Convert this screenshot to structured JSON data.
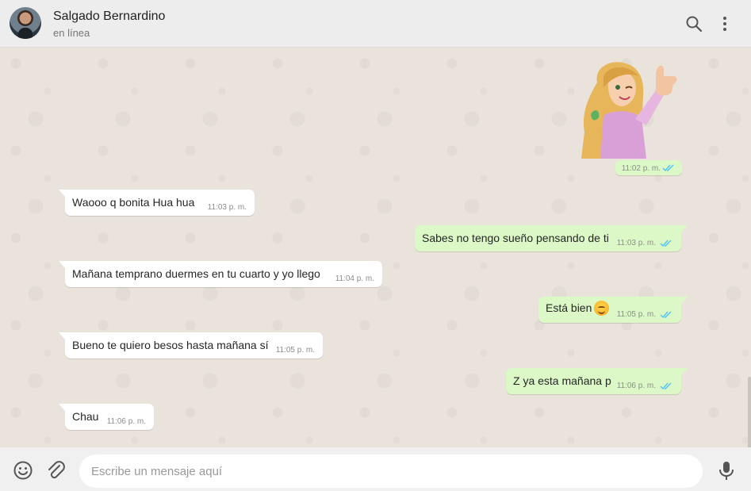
{
  "header": {
    "contact_name": "Salgado Bernardino",
    "contact_status": "en línea",
    "icons": [
      "avatar",
      "search-icon",
      "menu-icon"
    ]
  },
  "messages": [
    {
      "type": "sticker",
      "direction": "out",
      "time": "11:02 p. m.",
      "status": "read"
    },
    {
      "type": "text",
      "direction": "in",
      "text": "Waooo q bonita Hua hua",
      "time": "11:03 p. m."
    },
    {
      "type": "text",
      "direction": "out",
      "text": "Sabes no tengo sueño pensando de ti",
      "time": "11:03 p. m.",
      "status": "read"
    },
    {
      "type": "text",
      "direction": "in",
      "text": "Mañana temprano duermes en tu cuarto y yo llego",
      "time": "11:04 p. m."
    },
    {
      "type": "text",
      "direction": "out",
      "text": "Está bien",
      "emoji": "smiling-face",
      "time": "11:05 p. m.",
      "status": "read"
    },
    {
      "type": "text",
      "direction": "in",
      "text": "Bueno te quiero besos hasta mañana sí",
      "time": "11:05 p. m."
    },
    {
      "type": "text",
      "direction": "out",
      "text": "Z ya esta mañana p",
      "time": "11:06 p. m.",
      "status": "read"
    },
    {
      "type": "text",
      "direction": "in",
      "text": "Chau",
      "time": "11:06 p. m."
    }
  ],
  "composer": {
    "placeholder": "Escribe un mensaje aquí",
    "icons": [
      "emoji-icon",
      "attach-icon",
      "mic-icon"
    ]
  },
  "colors": {
    "header_bg": "#ededed",
    "chat_bg": "#e9e3dc",
    "outgoing_bubble": "#dcf8c6",
    "incoming_bubble": "#ffffff",
    "read_ticks": "#4fc3f7"
  }
}
